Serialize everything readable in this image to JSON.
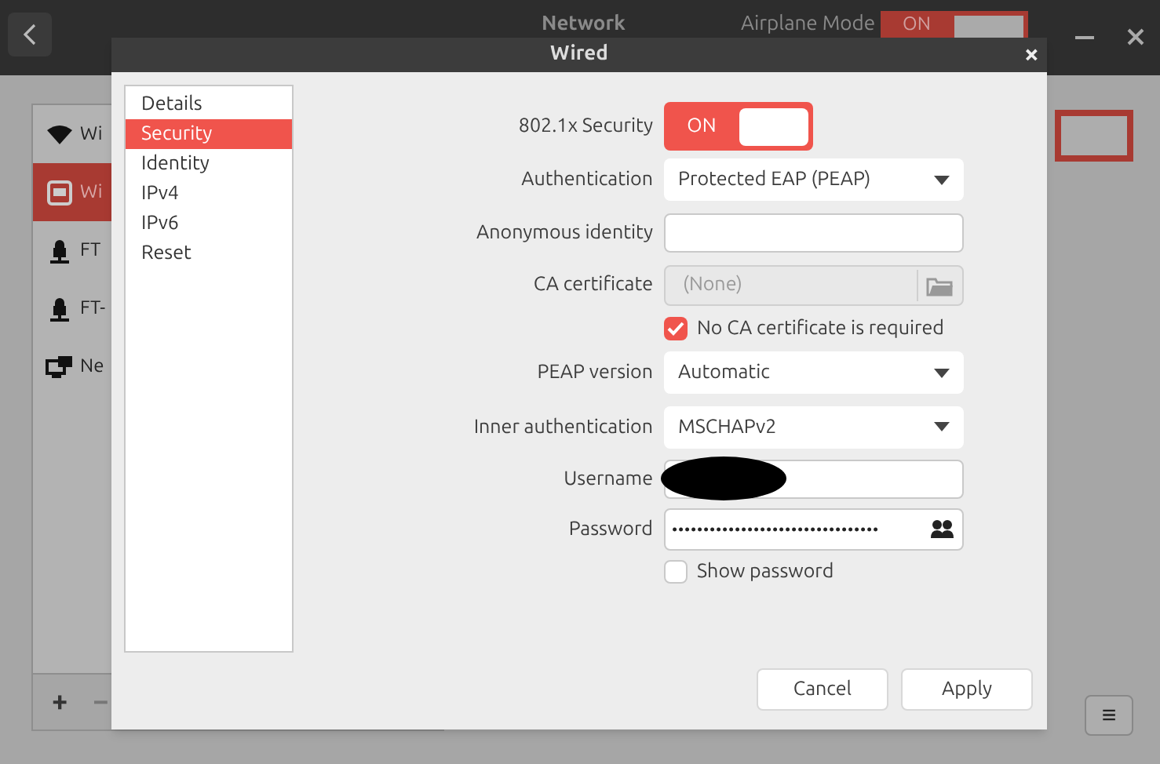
{
  "app": {
    "title": "Network",
    "airplane_mode": {
      "label": "Airplane Mode",
      "state_text": "ON",
      "on": true
    },
    "devices": [
      {
        "label": "Wi",
        "kind": "wifi",
        "selected": false
      },
      {
        "label": "Wi",
        "kind": "wired",
        "selected": true
      },
      {
        "label": "FT",
        "kind": "vpn",
        "selected": false
      },
      {
        "label": "FT-",
        "kind": "vpn",
        "selected": false
      },
      {
        "label": "Ne",
        "kind": "proxy",
        "selected": false
      }
    ],
    "add_symbol": "+",
    "remove_symbol": "−",
    "menu_symbol": "≡"
  },
  "dialog": {
    "title": "Wired",
    "close_symbol": "×",
    "pages": [
      {
        "label": "Details",
        "selected": false
      },
      {
        "label": "Security",
        "selected": true
      },
      {
        "label": "Identity",
        "selected": false
      },
      {
        "label": "IPv4",
        "selected": false
      },
      {
        "label": "IPv6",
        "selected": false
      },
      {
        "label": "Reset",
        "selected": false
      }
    ],
    "fields": [
      {
        "kind": "switch",
        "label": "802.1x Security",
        "state_text": "ON",
        "on": true
      },
      {
        "kind": "dropdown",
        "label": "Authentication",
        "value": "Protected EAP (PEAP)"
      },
      {
        "kind": "text",
        "label": "Anonymous identity"
      },
      {
        "kind": "file",
        "label": "CA certificate",
        "placeholder": "(None)",
        "disabled": true
      },
      {
        "kind": "checkbox",
        "label": "No CA certificate is required",
        "checked": true
      },
      {
        "kind": "dropdown",
        "label": "PEAP version",
        "value": "Automatic"
      },
      {
        "kind": "dropdown",
        "label": "Inner authentication",
        "value": "MSCHAPv2"
      },
      {
        "kind": "redacted",
        "label": "Username"
      },
      {
        "kind": "password",
        "label": "Password",
        "value": "•••••••••••••••••••••••••••••••••",
        "toggle": {
          "label": "Show password",
          "checked": false
        }
      }
    ],
    "buttons": [
      "Cancel",
      "Apply"
    ]
  }
}
